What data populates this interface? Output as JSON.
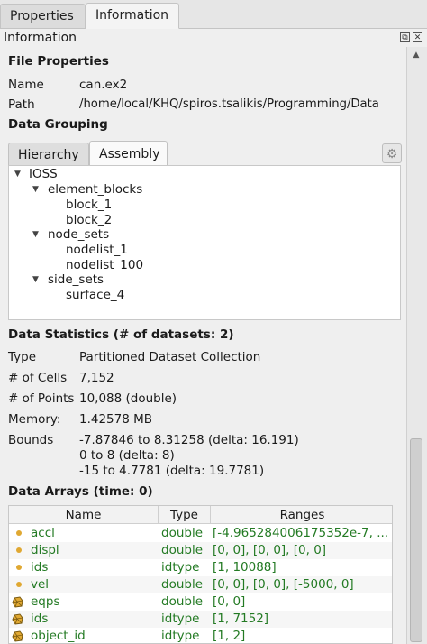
{
  "tabs": [
    {
      "label": "Properties"
    },
    {
      "label": "Information"
    }
  ],
  "panel_title": "Information",
  "file_properties": {
    "heading": "File Properties",
    "name_label": "Name",
    "name_value": "can.ex2",
    "path_label": "Path",
    "path_value": "/home/local/KHQ/spiros.tsalikis/Programming/Data"
  },
  "data_grouping": {
    "heading": "Data Grouping",
    "tabs": [
      {
        "label": "Hierarchy"
      },
      {
        "label": "Assembly"
      }
    ],
    "tree": [
      {
        "label": "IOSS"
      },
      {
        "label": "element_blocks"
      },
      {
        "label": "block_1"
      },
      {
        "label": "block_2"
      },
      {
        "label": "node_sets"
      },
      {
        "label": "nodelist_1"
      },
      {
        "label": "nodelist_100"
      },
      {
        "label": "side_sets"
      },
      {
        "label": "surface_4"
      }
    ]
  },
  "data_statistics": {
    "heading": "Data Statistics (# of datasets: 2)",
    "type_label": "Type",
    "type_value": "Partitioned Dataset Collection",
    "cells_label": "# of Cells",
    "cells_value": "7,152",
    "points_label": "# of Points",
    "points_value": "10,088 (double)",
    "memory_label": "Memory:",
    "memory_value": "1.42578 MB",
    "bounds_label": "Bounds",
    "bounds_values": [
      "-7.87846 to 8.31258 (delta: 16.191)",
      "0 to 8 (delta: 8)",
      "-15 to 4.7781 (delta: 19.7781)"
    ]
  },
  "data_arrays": {
    "heading": "Data Arrays (time: 0)",
    "columns": [
      "Name",
      "Type",
      "Ranges"
    ],
    "rows": [
      {
        "icon": "point-data-icon",
        "name": "accl",
        "type": "double",
        "ranges": "[-4.965284006175352e-7, ..."
      },
      {
        "icon": "point-data-icon",
        "name": "displ",
        "type": "double",
        "ranges": "[0, 0], [0, 0], [0, 0]"
      },
      {
        "icon": "point-data-icon",
        "name": "ids",
        "type": "idtype",
        "ranges": "[1, 10088]"
      },
      {
        "icon": "point-data-icon",
        "name": "vel",
        "type": "double",
        "ranges": "[0, 0], [0, 0], [-5000, 0]"
      },
      {
        "icon": "cell-data-icon",
        "name": "eqps",
        "type": "double",
        "ranges": "[0, 0]"
      },
      {
        "icon": "cell-data-icon",
        "name": "ids",
        "type": "idtype",
        "ranges": "[1, 7152]"
      },
      {
        "icon": "cell-data-icon",
        "name": "object_id",
        "type": "idtype",
        "ranges": "[1, 2]"
      }
    ]
  },
  "colors": {
    "array_text": "#237a23",
    "point_icon": "#e0a832",
    "cell_icon": "#e0a832"
  }
}
